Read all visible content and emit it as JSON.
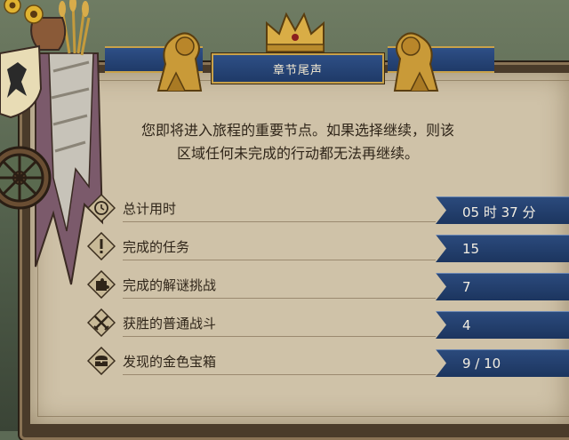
{
  "dialog": {
    "title": "章节尾声",
    "message_line1": "您即将进入旅程的重要节点。如果选择继续，则该",
    "message_line2": "区域任何未完成的行动都无法再继续。"
  },
  "stats": [
    {
      "icon": "clock-icon",
      "label": "总计用时",
      "value": "05 时 37 分"
    },
    {
      "icon": "exclamation-icon",
      "label": "完成的任务",
      "value": "15"
    },
    {
      "icon": "puzzle-icon",
      "label": "完成的解谜挑战",
      "value": "7"
    },
    {
      "icon": "crossed-swords-icon",
      "label": "获胜的普通战斗",
      "value": "4"
    },
    {
      "icon": "treasure-chest-icon",
      "label": "发现的金色宝箱",
      "value": "9 / 10"
    }
  ],
  "colors": {
    "banner": "#1f3a68",
    "gold": "#c9a24a",
    "parchment": "#cfc2a8",
    "text": "#2f2519"
  }
}
